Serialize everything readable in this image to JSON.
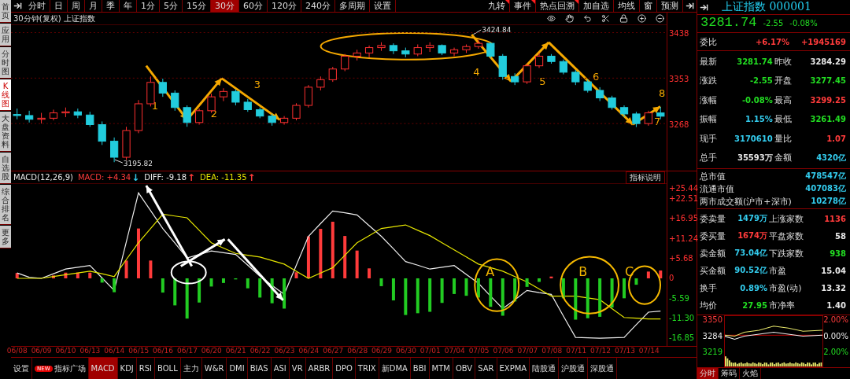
{
  "sidebar": {
    "items": [
      {
        "label": "首页",
        "selected": false
      },
      {
        "label": "应用",
        "selected": false
      },
      {
        "label": "分时图",
        "selected": false
      },
      {
        "label": "K线图",
        "selected": true
      },
      {
        "label": "大盘资料",
        "selected": false
      },
      {
        "label": "自选股",
        "selected": false
      },
      {
        "label": "综合排名",
        "selected": false
      },
      {
        "label": "更多",
        "selected": false
      }
    ]
  },
  "toolbar": {
    "period_tabs": [
      {
        "label": "分时",
        "selected": false
      },
      {
        "label": "日",
        "selected": false
      },
      {
        "label": "周",
        "selected": false
      },
      {
        "label": "月",
        "selected": false
      },
      {
        "label": "季",
        "selected": false
      },
      {
        "label": "年",
        "selected": false
      },
      {
        "label": "1分",
        "selected": false
      },
      {
        "label": "5分",
        "selected": false
      },
      {
        "label": "15分",
        "selected": false
      },
      {
        "label": "30分",
        "selected": true
      },
      {
        "label": "60分",
        "selected": false
      },
      {
        "label": "120分",
        "selected": false
      },
      {
        "label": "240分",
        "selected": false
      },
      {
        "label": "多周期",
        "selected": false
      },
      {
        "label": "设置",
        "selected": false
      }
    ],
    "tools": [
      {
        "label": "九转",
        "flagged": true
      },
      {
        "label": "事件",
        "flagged": true
      },
      {
        "label": "热点回溯",
        "flagged": true
      },
      {
        "label": "加自选",
        "flagged": false
      },
      {
        "label": "均线",
        "flagged": false
      },
      {
        "label": "窗",
        "flagged": false
      },
      {
        "label": "预测",
        "flagged": false
      }
    ]
  },
  "kline": {
    "title": "30分钟(复权)  上证指数",
    "high_label": "3424.84",
    "low_label": "3195.82",
    "wave_labels": [
      "1",
      "2",
      "3",
      "4",
      "5",
      "6",
      "7",
      "8"
    ],
    "chart_data": {
      "type": "candlestick",
      "categories": [
        null,
        null,
        null,
        null,
        null,
        null,
        null,
        null,
        null,
        null,
        null,
        null,
        null,
        null,
        null,
        null,
        null,
        null,
        null,
        null,
        null,
        null,
        null,
        null,
        null,
        null,
        null,
        null,
        null,
        null,
        null,
        null,
        null,
        null,
        null,
        null,
        null,
        null,
        null,
        null,
        null,
        null,
        null,
        null,
        null,
        null,
        null,
        null,
        null,
        null,
        null,
        null,
        null,
        null
      ],
      "ohlc": [
        [
          3285,
          3296,
          3276,
          3283
        ],
        [
          3283,
          3292,
          3270,
          3276
        ],
        [
          3276,
          3288,
          3268,
          3278
        ],
        [
          3278,
          3294,
          3274,
          3288
        ],
        [
          3288,
          3298,
          3280,
          3290
        ],
        [
          3290,
          3296,
          3278,
          3284
        ],
        [
          3284,
          3290,
          3262,
          3266
        ],
        [
          3266,
          3272,
          3228,
          3235
        ],
        [
          3235,
          3242,
          3195.82,
          3205
        ],
        [
          3205,
          3262,
          3200,
          3255
        ],
        [
          3255,
          3312,
          3250,
          3305
        ],
        [
          3305,
          3356,
          3300,
          3345
        ],
        [
          3345,
          3352,
          3318,
          3325
        ],
        [
          3325,
          3330,
          3292,
          3298
        ],
        [
          3298,
          3302,
          3262,
          3270
        ],
        [
          3270,
          3296,
          3266,
          3292
        ],
        [
          3292,
          3324,
          3288,
          3318
        ],
        [
          3318,
          3334,
          3310,
          3328
        ],
        [
          3328,
          3332,
          3302,
          3308
        ],
        [
          3308,
          3314,
          3290,
          3294
        ],
        [
          3294,
          3298,
          3278,
          3282
        ],
        [
          3282,
          3286,
          3264,
          3270
        ],
        [
          3270,
          3282,
          3266,
          3278
        ],
        [
          3278,
          3306,
          3274,
          3302
        ],
        [
          3302,
          3340,
          3298,
          3336
        ],
        [
          3336,
          3356,
          3330,
          3350
        ],
        [
          3350,
          3374,
          3346,
          3370
        ],
        [
          3370,
          3398,
          3366,
          3394
        ],
        [
          3394,
          3406,
          3386,
          3400
        ],
        [
          3400,
          3414,
          3392,
          3410
        ],
        [
          3410,
          3420,
          3404,
          3414
        ],
        [
          3414,
          3418,
          3398,
          3404
        ],
        [
          3404,
          3410,
          3392,
          3398
        ],
        [
          3398,
          3416,
          3394,
          3410
        ],
        [
          3410,
          3420,
          3402,
          3414
        ],
        [
          3414,
          3416,
          3396,
          3400
        ],
        [
          3400,
          3410,
          3394,
          3406
        ],
        [
          3406,
          3416,
          3400,
          3412
        ],
        [
          3412,
          3424.84,
          3408,
          3418
        ],
        [
          3418,
          3420,
          3390,
          3394
        ],
        [
          3394,
          3398,
          3350,
          3356
        ],
        [
          3356,
          3362,
          3340,
          3346
        ],
        [
          3346,
          3380,
          3342,
          3376
        ],
        [
          3376,
          3400,
          3372,
          3394
        ],
        [
          3394,
          3398,
          3380,
          3384
        ],
        [
          3384,
          3388,
          3360,
          3364
        ],
        [
          3364,
          3368,
          3340,
          3346
        ],
        [
          3346,
          3350,
          3326,
          3330
        ],
        [
          3330,
          3336,
          3310,
          3316
        ],
        [
          3316,
          3320,
          3294,
          3298
        ],
        [
          3298,
          3302,
          3280,
          3286
        ],
        [
          3286,
          3290,
          3261.49,
          3268
        ],
        [
          3268,
          3292,
          3264,
          3288
        ],
        [
          3288,
          3299.25,
          3276,
          3281.74
        ]
      ],
      "ylim": [
        3180,
        3452
      ],
      "yticks": [
        3268,
        3353,
        3438
      ],
      "grid": true
    }
  },
  "macd": {
    "indicator": "MACD(12,26,9)",
    "help_button": "指标说明",
    "zone_labels": [
      "A",
      "B",
      "C"
    ],
    "legend": [
      {
        "separator": ":",
        "value": "+4.34",
        "arrow": {
          "text": "↓",
          "color": "#33ccee"
        }
      },
      {
        "separator": ":",
        "value": "-9.18",
        "arrow": {
          "text": "↑",
          "color": "#ff3b3b"
        }
      },
      {
        "separator": ":",
        "value": "-11.35",
        "arrow": {
          "text": "↑",
          "color": "#ff3b3b"
        }
      }
    ],
    "chart_data": {
      "type": "line",
      "categories": [
        "06/08",
        null,
        "06/09",
        null,
        "06/10",
        null,
        "06/13",
        null,
        "06/14",
        null,
        "06/15",
        null,
        "06/16",
        null,
        "06/17",
        null,
        "06/20",
        null,
        "06/21",
        null,
        "06/22",
        null,
        "06/23",
        null,
        "06/24",
        null,
        "06/27",
        null,
        "06/28",
        null,
        "06/29",
        null,
        "06/30",
        null,
        "07/01",
        null,
        "07/04",
        null,
        "07/05",
        null,
        "07/06",
        null,
        "07/07",
        null,
        "07/08",
        null,
        "07/11",
        null,
        "07/12",
        null,
        "07/13",
        null,
        "07/14",
        null
      ],
      "series": [
        {
          "name": "MACD",
          "type": "bar",
          "color": "#ff3b3b",
          "values": [
            1.5,
            null,
            null,
            0.8,
            1.6,
            1.6,
            1.6,
            null,
            null,
            5,
            14,
            5,
            null,
            null,
            null,
            null,
            null,
            null,
            null,
            null,
            null,
            null,
            null,
            1.7,
            11.8,
            13.9,
            15.9,
            11.9,
            7.8,
            2.8,
            null,
            null,
            null,
            null,
            null,
            null,
            null,
            null,
            null,
            null,
            null,
            null,
            null,
            null,
            0.5,
            null,
            null,
            null,
            null,
            null,
            null,
            null,
            1.9,
            2.2
          ]
        },
        {
          "name": "DIFF",
          "color": "#eeeeee",
          "values": [
            1.5,
            0.3,
            0,
            1.3,
            2.6,
            3.1,
            3.6,
            0.1,
            -3.4,
            10.3,
            24,
            19,
            14,
            9.9,
            5.7,
            6.7,
            7.7,
            7.2,
            6.7,
            3.7,
            0.6,
            -2,
            -4.5,
            3.7,
            11.8,
            15.4,
            18.9,
            18.4,
            17.8,
            14.8,
            11.8,
            8.3,
            4.7,
            3.7,
            2.6,
            3.1,
            3.6,
            1.1,
            -1.4,
            -5,
            -8.5,
            -6,
            -3.4,
            -4,
            -4.5,
            -10.6,
            -16.6,
            -16.7,
            -16.8,
            -16.7,
            -16.6,
            -13,
            -9.5,
            -9.2
          ]
        },
        {
          "name": "DEA",
          "color": "#e6e600",
          "values": [
            0,
            0,
            0,
            0.5,
            1,
            1.5,
            2,
            1.3,
            0.5,
            5.3,
            10,
            14,
            18,
            17.5,
            17,
            13.5,
            10,
            8.5,
            7,
            6.5,
            6,
            5,
            4,
            2,
            0,
            1.5,
            3,
            6.5,
            10,
            12,
            14,
            14.5,
            15,
            13.5,
            12,
            10,
            8,
            6,
            4,
            3,
            2,
            0.5,
            -1,
            -3,
            -5,
            -5,
            -5,
            -5.5,
            -6,
            -8.5,
            -11,
            -11.2,
            -11.4,
            -11.4
          ]
        },
        {
          "type": "bar",
          "color": "#22cc22",
          "values": [
            null,
            null,
            null,
            null,
            null,
            null,
            null,
            -1.2,
            -3.9,
            null,
            null,
            null,
            -4,
            -7.6,
            -11.3,
            -6.8,
            -2.3,
            -1.3,
            -0.3,
            -2.8,
            -5.4,
            -7,
            -8.5,
            null,
            null,
            null,
            null,
            null,
            null,
            null,
            -2.2,
            -6.2,
            -10.3,
            -9.8,
            -9.4,
            -6.9,
            -4.4,
            -4.9,
            -5.4,
            -8,
            -10.5,
            -6.5,
            -2.4,
            -1,
            null,
            -5.6,
            -11.6,
            -11.2,
            -10.8,
            -8.2,
            -5.6,
            -1.8,
            null,
            null
          ]
        }
      ],
      "ylim": [
        -19,
        26.5
      ],
      "yticks": [
        {
          "value": 25.44,
          "label": "+25.44"
        },
        {
          "value": 22.51,
          "label": "+22.51"
        },
        {
          "value": 16.95,
          "label": "+16.95"
        },
        {
          "value": 11.24,
          "label": "+11.24"
        },
        {
          "value": 5.68,
          "label": "+5.68"
        },
        {
          "value": 0,
          "label": "0"
        },
        {
          "value": -5.59,
          "label": "-5.59"
        },
        {
          "value": -11.3,
          "label": "-11.30"
        },
        {
          "value": -16.85,
          "label": "-16.85"
        }
      ]
    }
  },
  "indicator_tabs": [
    {
      "label": "设置",
      "selected": false
    },
    {
      "label": "指标广场",
      "selected": false,
      "badge": "NEW"
    },
    {
      "label": "MACD",
      "selected": true
    },
    {
      "label": "KDJ",
      "selected": false
    },
    {
      "label": "RSI",
      "selected": false
    },
    {
      "label": "BOLL",
      "selected": false
    },
    {
      "label": "主力",
      "selected": false
    },
    {
      "label": "W&R",
      "selected": false
    },
    {
      "label": "DMI",
      "selected": false
    },
    {
      "label": "BIAS",
      "selected": false
    },
    {
      "label": "ASI",
      "selected": false
    },
    {
      "label": "VR",
      "selected": false
    },
    {
      "label": "ARBR",
      "selected": false
    },
    {
      "label": "DPO",
      "selected": false
    },
    {
      "label": "TRIX",
      "selected": false
    },
    {
      "label": "新DMA",
      "selected": false
    },
    {
      "label": "BBI",
      "selected": false
    },
    {
      "label": "MTM",
      "selected": false
    },
    {
      "label": "OBV",
      "selected": false
    },
    {
      "label": "SAR",
      "selected": false
    },
    {
      "label": "EXPMA",
      "selected": false
    },
    {
      "label": "陆股通",
      "selected": false
    },
    {
      "label": "沪股通",
      "selected": false
    },
    {
      "label": "深股通",
      "selected": false
    }
  ],
  "quote": {
    "name": "上证指数",
    "code": "000001",
    "price": "3281.74",
    "change": "-2.55",
    "change_pct": "-0.08%",
    "ratio": {
      "label": "委比",
      "pct": "+6.17%",
      "diff": "+1945169"
    },
    "stats": [
      {
        "label": "最新",
        "value": "3281.74",
        "color": "#22dd22"
      },
      {
        "label": "昨收",
        "value": "3284.29",
        "color": "#e8e8e8"
      },
      {
        "label": "涨跌",
        "value": "-2.55",
        "color": "#22dd22"
      },
      {
        "label": "开盘",
        "value": "3277.45",
        "color": "#22dd22"
      },
      {
        "label": "涨幅",
        "value": "-0.08%",
        "color": "#22dd22"
      },
      {
        "label": "最高",
        "value": "3299.25",
        "color": "#ff3b3b"
      },
      {
        "label": "振幅",
        "value": "1.15%",
        "color": "#33ccee"
      },
      {
        "label": "最低",
        "value": "3261.49",
        "color": "#22dd22"
      },
      {
        "label": "现手",
        "value": "3170610",
        "color": "#33ccee"
      },
      {
        "label": "量比",
        "value": "1.07",
        "color": "#ff3b3b"
      },
      {
        "label": "总手",
        "value": "35593万",
        "color": "#e8e8e8"
      },
      {
        "label": "金额",
        "value": "4320亿",
        "color": "#33ccee"
      }
    ],
    "market": [
      {
        "label": "总市值",
        "value": "478547亿"
      },
      {
        "label": "流通市值",
        "value": "407083亿"
      },
      {
        "label": "两市成交额(沪市+深市)",
        "value": "10278亿"
      }
    ],
    "breadth": [
      {
        "label": "委卖量",
        "value": "1479万",
        "color": "#33ccee"
      },
      {
        "label": "上涨家数",
        "value": "1136",
        "color": "#ff3b3b"
      },
      {
        "label": "委买量",
        "value": "1674万",
        "color": "#ff3b3b"
      },
      {
        "label": "平盘家数",
        "value": "58",
        "color": "#e8e8e8"
      },
      {
        "label": "卖金额",
        "value": "73.04亿",
        "color": "#33ccee"
      },
      {
        "label": "下跌家数",
        "value": "938",
        "color": "#22dd22"
      },
      {
        "label": "买金额",
        "value": "90.52亿",
        "color": "#33ccee"
      },
      {
        "label": "市盈",
        "value": "15.04",
        "color": "#e8e8e8"
      },
      {
        "label": "换手",
        "value": "0.89%",
        "color": "#33ccee"
      },
      {
        "label": "市盈(动)",
        "value": "13.32",
        "color": "#e8e8e8"
      },
      {
        "label": "均价",
        "value": "27.95",
        "color": "#22dd22"
      },
      {
        "label": "市净率",
        "value": "1.40",
        "color": "#e8e8e8"
      }
    ],
    "mini_chart": {
      "left_axis": [
        {
          "text": "3350",
          "color": "#ff3b3b"
        },
        {
          "text": "3284",
          "color": "#e8e8e8"
        },
        {
          "text": "3219",
          "color": "#22dd22"
        }
      ],
      "right_axis": [
        {
          "text": "2.00%",
          "color": "#ff3b3b"
        },
        {
          "text": "0.00%",
          "color": "#e8e8e8"
        },
        {
          "text": "2.00%",
          "color": "#22dd22"
        }
      ]
    },
    "tabs": [
      {
        "label": "分时",
        "selected": true
      },
      {
        "label": "筹码",
        "selected": false
      },
      {
        "label": "火焰",
        "selected": false
      }
    ]
  }
}
